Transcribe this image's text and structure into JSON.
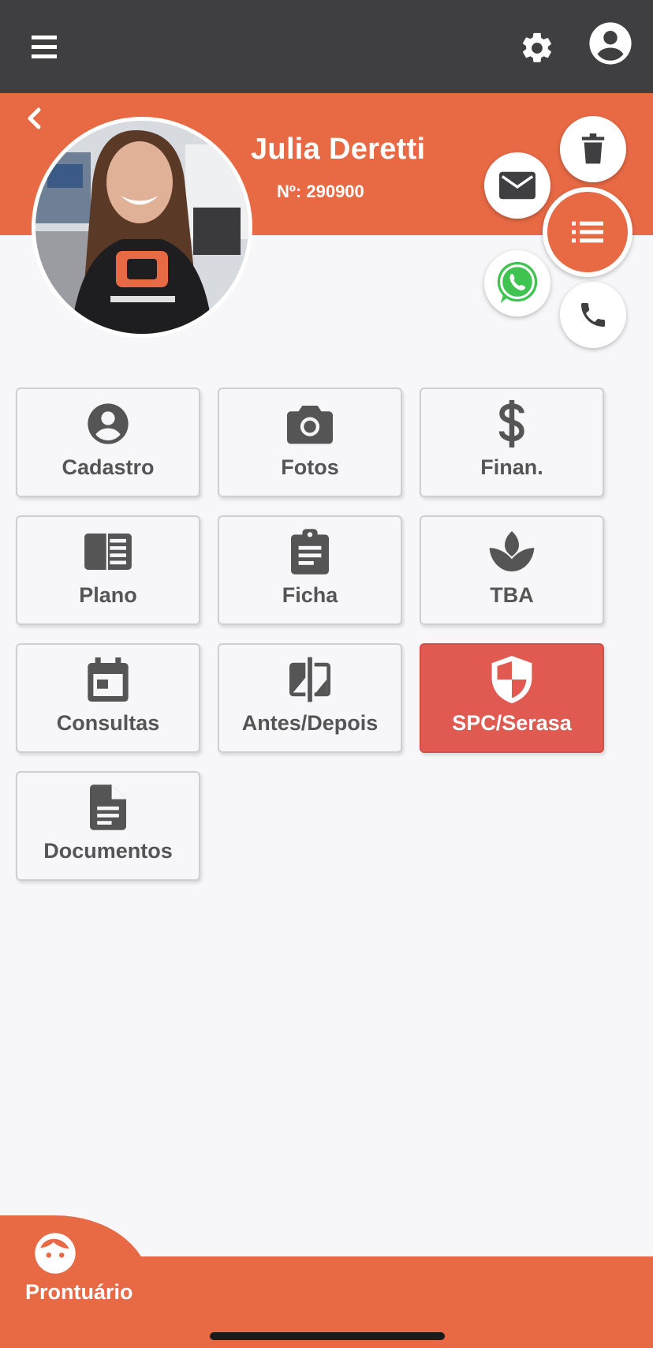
{
  "colors": {
    "topbar": "#3f3e40",
    "accent": "#e86a45",
    "alert": "#e05a52",
    "tile_text": "#555555",
    "background": "#f7f6f9"
  },
  "topbar": {
    "icons": [
      "menu-icon",
      "gear-icon",
      "account-circle-icon"
    ]
  },
  "patient": {
    "name": "Julia Deretti",
    "number": "Nº: 290900"
  },
  "actions": [
    "delete-icon",
    "mail-icon",
    "list-icon",
    "whatsapp-icon",
    "phone-icon"
  ],
  "tiles": [
    {
      "label": "Cadastro",
      "icon": "account-circle-icon"
    },
    {
      "label": "Fotos",
      "icon": "camera-icon"
    },
    {
      "label": "Finan.",
      "icon": "dollar-icon"
    },
    {
      "label": "Plano",
      "icon": "plan-book-icon"
    },
    {
      "label": "Ficha",
      "icon": "clipboard-icon"
    },
    {
      "label": "TBA",
      "icon": "lotus-icon"
    },
    {
      "label": "Consultas",
      "icon": "calendar-icon"
    },
    {
      "label": "Antes/Depois",
      "icon": "compare-icon"
    },
    {
      "label": "SPC/Serasa",
      "icon": "shield-icon"
    },
    {
      "label": "Documentos",
      "icon": "document-icon"
    }
  ],
  "bottom_nav": {
    "active_tab": "Prontuário",
    "icon": "face-icon"
  }
}
